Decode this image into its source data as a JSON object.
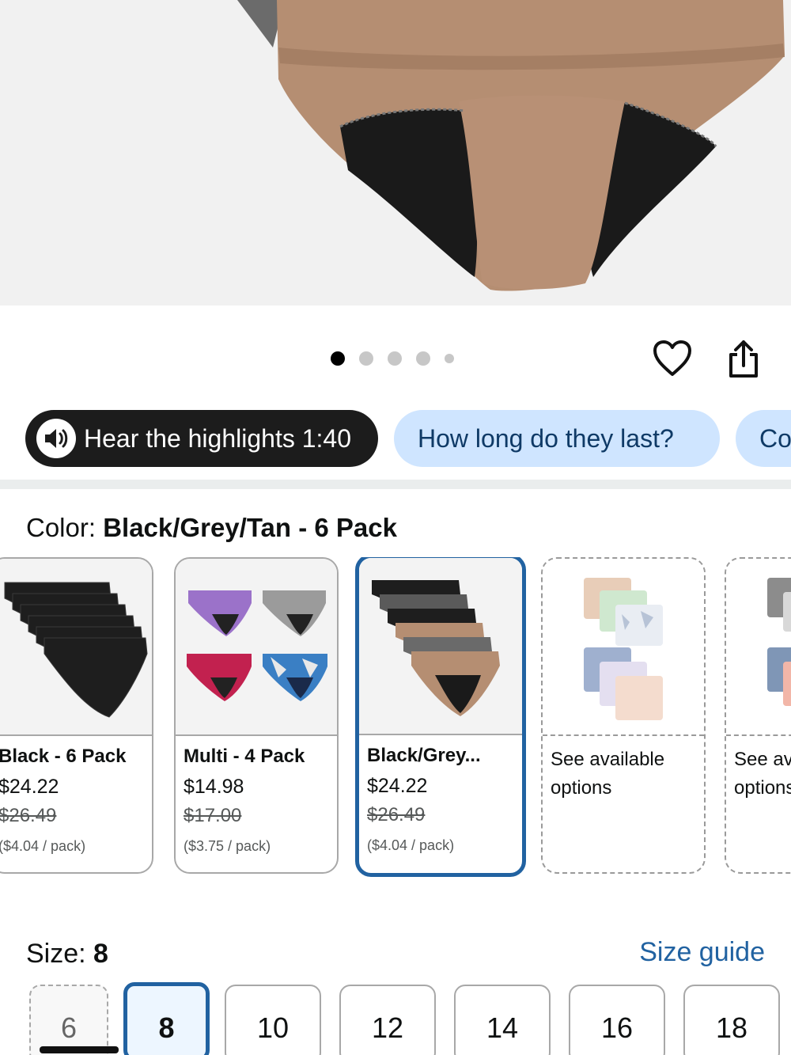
{
  "actions": {
    "wishlist_icon": "heart-icon",
    "share_icon": "share-icon"
  },
  "carousel": {
    "total_dots": 5,
    "active_index": 0
  },
  "chips": {
    "audio_label": "Hear the highlights 1:40",
    "audio_icon": "speaker-icon",
    "question_1": "How long do they last?",
    "question_2": "Co"
  },
  "color": {
    "label": "Color: ",
    "value": "Black/Grey/Tan - 6 Pack",
    "options": [
      {
        "name": "Black - 6 Pack",
        "price": "$24.22",
        "list_price": "$26.49",
        "unit": "($4.04 / pack)"
      },
      {
        "name": "Multi - 4 Pack",
        "price": "$14.98",
        "list_price": "$17.00",
        "unit": "($3.75 / pack)"
      },
      {
        "name": "Black/Grey...",
        "price": "$24.22",
        "list_price": "$26.49",
        "unit": "($4.04 / pack)",
        "selected": true
      },
      {
        "name": "See available options"
      },
      {
        "name": "See available options"
      }
    ]
  },
  "size": {
    "label": "Size: ",
    "value": "8",
    "guide": "Size guide",
    "options": [
      "6",
      "8",
      "10",
      "12",
      "14",
      "16",
      "18"
    ]
  },
  "colors": {
    "accent": "#2162a1",
    "chip_blue": "#cfe5ff",
    "chip_dark": "#1c1c1c",
    "product_tan": "#b58e72"
  }
}
